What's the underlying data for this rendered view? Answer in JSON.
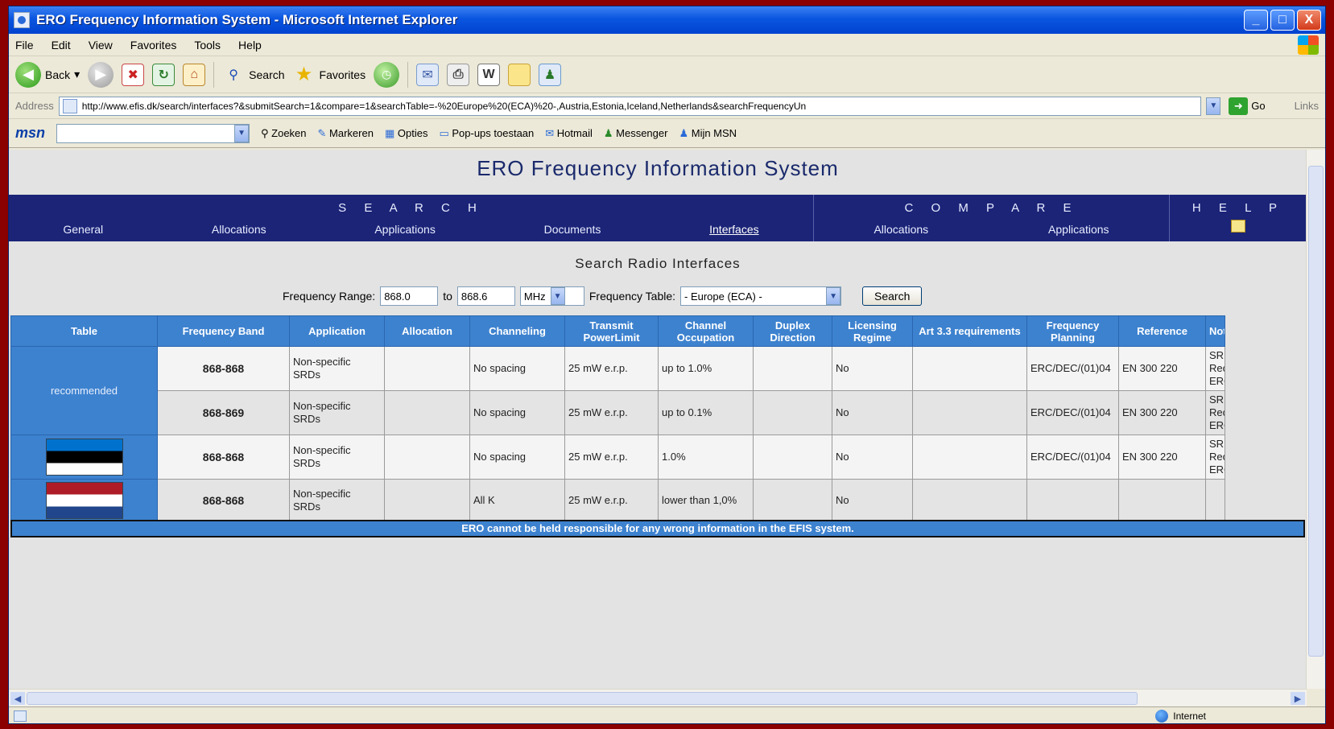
{
  "window": {
    "title": "ERO Frequency Information System - Microsoft Internet Explorer",
    "controls": [
      "_",
      "□",
      "X"
    ]
  },
  "menu": [
    "File",
    "Edit",
    "View",
    "Favorites",
    "Tools",
    "Help"
  ],
  "toolbar": {
    "back": "Back",
    "search": "Search",
    "favorites": "Favorites"
  },
  "address": {
    "label": "Address",
    "url": "http://www.efis.dk/search/interfaces?&submitSearch=1&compare=1&searchTable=-%20Europe%20(ECA)%20-,Austria,Estonia,Iceland,Netherlands&searchFrequencyUn",
    "go": "Go",
    "links": "Links"
  },
  "msnbar": {
    "logo": "msn",
    "items": [
      "Zoeken",
      "Markeren",
      "Opties",
      "Pop-ups toestaan",
      "Hotmail",
      "Messenger",
      "Mijn MSN"
    ]
  },
  "page": {
    "site_title": "ERO Frequency Information System",
    "nav": {
      "search_head": "S E A R C H",
      "search_items": [
        "General",
        "Allocations",
        "Applications",
        "Documents",
        "Interfaces"
      ],
      "compare_head": "C O M P A R E",
      "compare_items": [
        "Allocations",
        "Applications"
      ],
      "help_head": "H E L P"
    },
    "subheading": "Search Radio Interfaces",
    "form": {
      "freq_label": "Frequency Range:",
      "from": "868.0",
      "to_label": "to",
      "to": "868.6",
      "unit": "MHz",
      "table_label": "Frequency Table:",
      "table_value": "- Europe (ECA) -",
      "search_button": "Search"
    },
    "table": {
      "headers": [
        "Table",
        "Frequency Band",
        "Application",
        "Allocation",
        "Channeling",
        "Transmit PowerLimit",
        "Channel Occupation",
        "Duplex Direction",
        "Licensing Regime",
        "Art 3.3 requirements",
        "Frequency Planning",
        "Reference",
        "Notes"
      ],
      "group_label": "recommended",
      "rows": [
        {
          "band": "868-868",
          "application": "Non-specific SRDs",
          "allocation": "",
          "channeling": "No spacing",
          "power": "25 mW e.r.p.",
          "occupation": "up to 1.0%",
          "duplex": "",
          "licensing": "No",
          "art33": "",
          "planning": "ERC/DEC/(01)04",
          "reference": "EN 300 220",
          "notes": "SRD Recom ERC/"
        },
        {
          "band": "868-869",
          "application": "Non-specific SRDs",
          "allocation": "",
          "channeling": "No spacing",
          "power": "25 mW e.r.p.",
          "occupation": "up to 0.1%",
          "duplex": "",
          "licensing": "No",
          "art33": "",
          "planning": "ERC/DEC/(01)04",
          "reference": "EN 300 220",
          "notes": "SRD Recom ERC/"
        },
        {
          "flag": "estonia-flag",
          "band": "868-868",
          "application": "Non-specific SRDs",
          "allocation": "",
          "channeling": "No spacing",
          "power": "25 mW e.r.p.",
          "occupation": "1.0%",
          "duplex": "",
          "licensing": "No",
          "art33": "",
          "planning": "ERC/DEC/(01)04",
          "reference": "EN 300 220",
          "notes": "SRD Recom ERC/"
        },
        {
          "flag": "netherlands-flag",
          "band": "868-868",
          "application": "Non-specific SRDs",
          "allocation": "",
          "channeling": "All K",
          "power": "25 mW e.r.p.",
          "occupation": "lower than 1,0%",
          "duplex": "",
          "licensing": "No",
          "art33": "",
          "planning": "",
          "reference": "",
          "notes": ""
        }
      ]
    },
    "disclaimer": "ERO cannot be held responsible for any wrong information in the EFIS system."
  },
  "status": {
    "zone": "Internet"
  },
  "colors": {
    "nav_bg": "#1b2477",
    "header_bg": "#3d82cf",
    "frame": "#8b0000"
  }
}
